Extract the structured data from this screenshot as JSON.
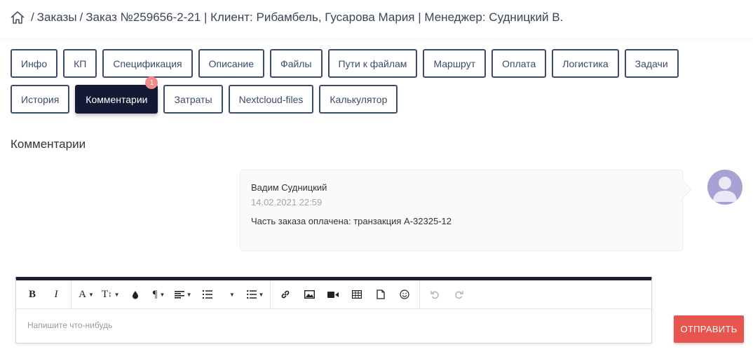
{
  "breadcrumb": {
    "home_icon": "home-icon",
    "items": [
      "Заказы",
      "Заказ №259656-2-21 | Клиент: Рибамбель, Гусарова Мария | Менеджер: Судницкий В."
    ],
    "separator": "/"
  },
  "tabs": {
    "row1": [
      "Инфо",
      "КП",
      "Спецификация",
      "Описание",
      "Файлы",
      "Пути к файлам",
      "Маршрут",
      "Оплата",
      "Логистика",
      "Задачи"
    ],
    "row2": [
      "История",
      "Комментарии",
      "Затраты",
      "Nextcloud-files",
      "Калькулятор"
    ],
    "active": "Комментарии",
    "badge": "1"
  },
  "section_title": "Комментарии",
  "comment": {
    "author": "Вадим Судницкий",
    "date": "14.02.2021 22:59",
    "text": "Часть заказа оплачена: транзакция А-32325-12"
  },
  "editor": {
    "placeholder": "Напишите что-нибудь",
    "toolbar": [
      "bold",
      "italic",
      "font-color",
      "font-size",
      "color-drop",
      "paragraph",
      "align",
      "ordered-list",
      "unordered-list",
      "link",
      "image",
      "video",
      "table",
      "file",
      "emoji",
      "undo",
      "redo"
    ],
    "bold_label": "B",
    "italic_label": "I",
    "font_label": "A",
    "size_label": "T",
    "para_label": "¶"
  },
  "send_button": "ОТПРАВИТЬ",
  "colors": {
    "accent": "#141a35",
    "tab_border": "#3b4c6b",
    "send": "#e8554e",
    "badge": "#f18a8a",
    "avatar": "#a6a3d4"
  }
}
